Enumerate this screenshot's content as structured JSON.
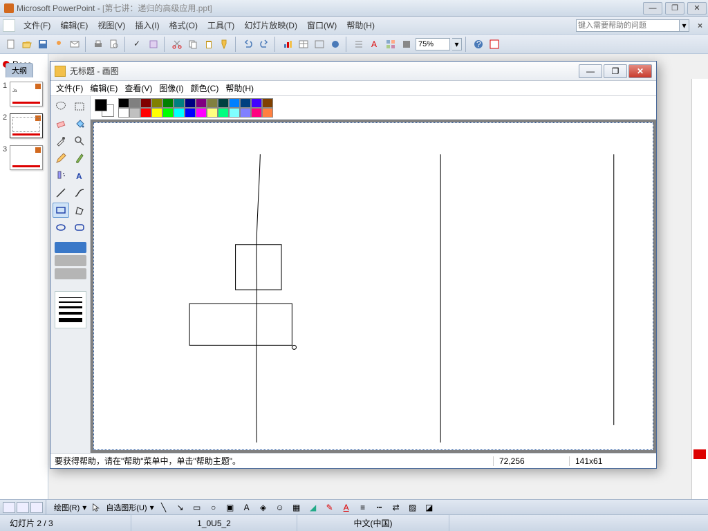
{
  "ppt": {
    "titlebar": {
      "app": "Microsoft PowerPoint - ",
      "doc": "[第七讲：递归的高级应用.ppt]"
    },
    "menu": [
      "文件(F)",
      "编辑(E)",
      "视图(V)",
      "插入(I)",
      "格式(O)",
      "工具(T)",
      "幻灯片放映(D)",
      "窗口(W)",
      "帮助(H)"
    ],
    "help_placeholder": "键入需要帮助的问题",
    "zoom": "75%",
    "outline": {
      "rec": "Reco",
      "tab": "大纲"
    },
    "thumbs": [
      {
        "num": "1",
        "text": "Ja"
      },
      {
        "num": "2",
        "text": ""
      },
      {
        "num": "3",
        "text": ""
      }
    ],
    "draw": {
      "label": "绘图(R)",
      "autoshape": "自选图形(U)"
    },
    "status": {
      "slide": "幻灯片 2 / 3",
      "design": "1_0U5_2",
      "lang": "中文(中国)"
    }
  },
  "paint": {
    "title": "无标题 - 画图",
    "menu": [
      "文件(F)",
      "编辑(E)",
      "查看(V)",
      "图像(I)",
      "颜色(C)",
      "帮助(H)"
    ],
    "palette_row1": [
      "#000000",
      "#808080",
      "#800000",
      "#808000",
      "#008000",
      "#008080",
      "#000080",
      "#800080",
      "#808040",
      "#004040",
      "#0080ff",
      "#004080",
      "#4000ff",
      "#804000"
    ],
    "palette_row2": [
      "#ffffff",
      "#c0c0c0",
      "#ff0000",
      "#ffff00",
      "#00ff00",
      "#00ffff",
      "#0000ff",
      "#ff00ff",
      "#ffff80",
      "#00ff80",
      "#80ffff",
      "#8080ff",
      "#ff0080",
      "#ff8040"
    ],
    "status": {
      "help": "要获得帮助，请在\"帮助\"菜单中，单击\"帮助主题\"。",
      "coords": "72,256",
      "size": "141x61"
    }
  }
}
